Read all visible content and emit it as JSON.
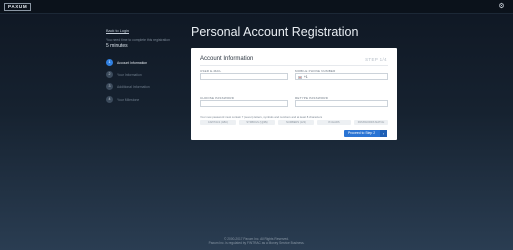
{
  "app": {
    "logo": "PAXUM"
  },
  "sidebar": {
    "back_link": "Back to Login",
    "time_note": "You need time to complete this registration",
    "time_value": "5 minutes",
    "steps": [
      {
        "num": "1",
        "label": "Account Information",
        "active": true
      },
      {
        "num": "2",
        "label": "Your Information",
        "active": false
      },
      {
        "num": "3",
        "label": "Additional Information",
        "active": false
      },
      {
        "num": "4",
        "label": "Your Milestone",
        "active": false
      }
    ]
  },
  "main": {
    "page_title": "Personal Account Registration",
    "card": {
      "title": "Account Information",
      "step_count": "STEP 1/4",
      "user_email_label": "USER E-MAIL",
      "user_email_value": "",
      "mobile_label": "MOBILE PHONE NUMBER",
      "mobile_value": "+1",
      "choose_password_label": "CHOOSE PASSWORD",
      "retype_password_label": "RETYPE PASSWORD",
      "password_hint": "Your new password must contain 7 (seven) letters, symbols and numbers and at least 8 characters",
      "requirements": [
        "CAPITALS (ABC)",
        "SYMBOLS (!@#$)",
        "NUMBERS (123)",
        "8 CHARS",
        "PASSWORDS MATCH"
      ],
      "proceed_label": "Proceed to Step 2"
    }
  },
  "footer": {
    "copyright": "© 2000-2017 Paxum Inc. All Rights Reserved.",
    "notice": "Paxum Inc. is regulated by FINTRAC as a Money Service Business."
  },
  "colors": {
    "accent": "#2a74d4",
    "active_step": "#2f7fe0",
    "background_top": "#0f1723",
    "background_bottom": "#2a3d52"
  }
}
